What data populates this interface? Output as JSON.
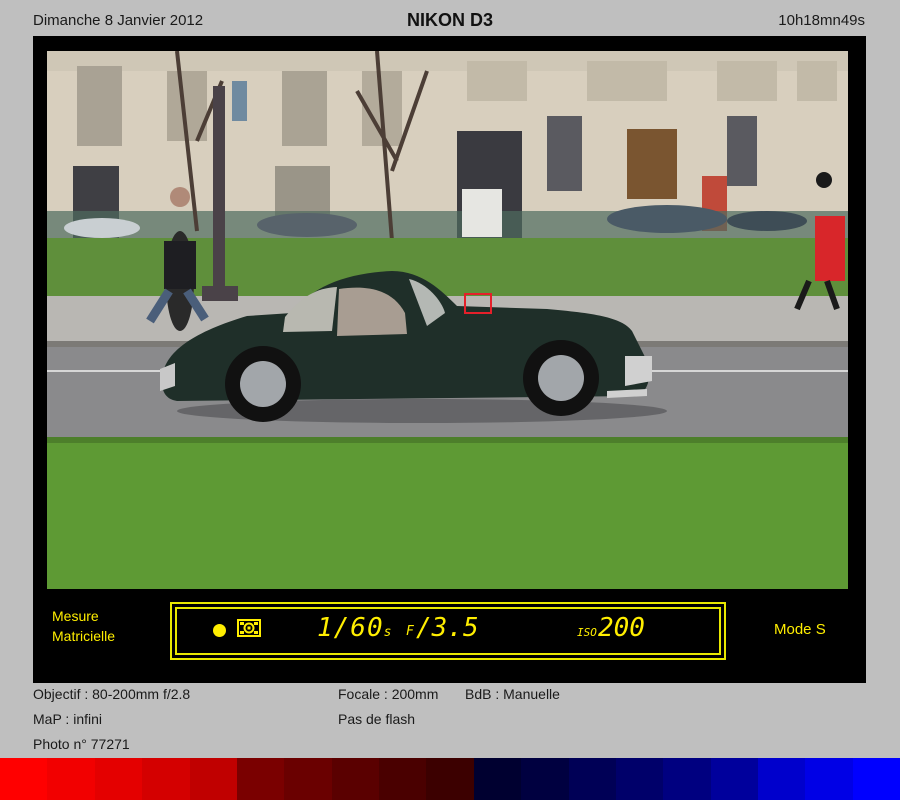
{
  "header": {
    "date": "Dimanche 8 Janvier 2012",
    "camera": "NIKON D3",
    "time": "10h18mn49s"
  },
  "viewfinder": {
    "metering_line1": "Mesure",
    "metering_line2": "Matricielle",
    "shutter": "1/60",
    "shutter_unit": "s",
    "aperture_prefix": "F",
    "aperture": "/3.5",
    "iso_label": "ISO",
    "iso": "200",
    "mode": "Mode S"
  },
  "info": {
    "objectif": "Objectif : 80-200mm f/2.8",
    "focale": "Focale : 200mm",
    "bdb": "BdB : Manuelle",
    "map": "MaP : infini",
    "flash": "Pas de flash",
    "photo": "Photo n° 77271"
  },
  "colors": {
    "lcd": "#ffee00",
    "af_point": "#e5202a",
    "stripe": [
      "#ff0000",
      "#f20000",
      "#e40000",
      "#d40000",
      "#c00000",
      "#7a0000",
      "#6a0000",
      "#5a0000",
      "#4a0000",
      "#3c0000",
      "#000030",
      "#000040",
      "#000056",
      "#00006a",
      "#000080",
      "#00009c",
      "#0000cc",
      "#0000e6",
      "#0000ff"
    ]
  }
}
